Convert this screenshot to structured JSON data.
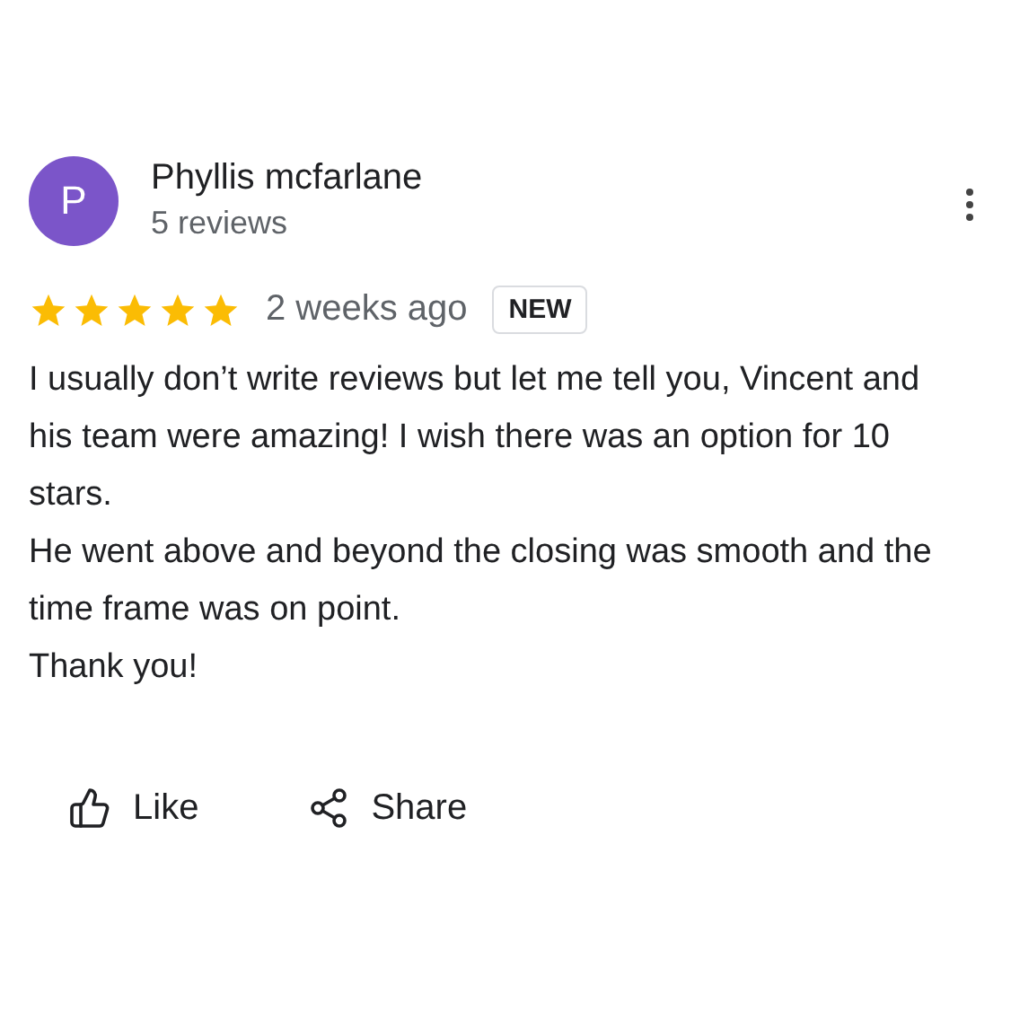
{
  "review": {
    "avatar_letter": "P",
    "author": "Phyllis mcfarlane",
    "author_meta": "5 reviews",
    "stars": 5,
    "time": "2 weeks ago",
    "badge": "NEW",
    "paragraphs": [
      "I usually don’t write reviews but let me tell you, Vincent and his team were amazing! I wish there was an option for 10 stars.",
      "He went above and beyond the closing was smooth and the time frame was on point.",
      "Thank you!"
    ],
    "actions": [
      {
        "kind": "like",
        "label": "Like"
      },
      {
        "kind": "share",
        "label": "Share"
      }
    ]
  }
}
